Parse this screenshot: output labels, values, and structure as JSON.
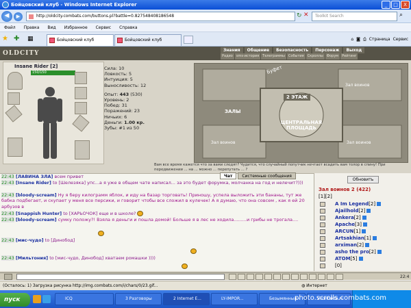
{
  "window": {
    "title": "Бойцовский клуб - Windows Internet Explorer",
    "minimize": "_",
    "maximize": "□",
    "close": "X"
  },
  "address": {
    "url": "http://oldcity.combats.com/buttons.pl?battle=0.827548408186548",
    "search_placeholder": "Toolkit Search"
  },
  "menu": [
    "Файл",
    "Правка",
    "Вид",
    "Избранное",
    "Сервис",
    "Справка"
  ],
  "tabs": [
    {
      "label": "Бойцовский клуб"
    },
    {
      "label": "Бойцовский клуб"
    }
  ],
  "ie_tools": {
    "page": "Страница",
    "service": "Сервис"
  },
  "game": {
    "logo": "OLDCITY",
    "menu_main": [
      "Знания",
      "Общение",
      "Безопасность",
      "Персонаж",
      "Выход"
    ],
    "menu_sub": [
      "Радио",
      "sms-история",
      "Телеграммы",
      "События",
      "Скроллы",
      "Форум",
      "Рейтинг"
    ],
    "character": {
      "name": "Insane Rider",
      "level": "[2]",
      "hp": "150/150"
    },
    "stats": {
      "strength": "Сила: 10",
      "agility": "Ловкость: 5",
      "intuition": "Интуиция: 5",
      "endurance": "Выносливость: 12",
      "exp_label": "Опыт:",
      "exp_value": "443",
      "exp_next": "(530)",
      "level": "Уровень: 2",
      "wins": "Побед: 31",
      "losses": "Поражений: 23",
      "draws": "Ничьих: 6",
      "money_label": "Деньги:",
      "money_value": "1.00 кр.",
      "teeth": "Зубы: #1 из 50"
    },
    "map": {
      "buffet": "Буфет",
      "floor2": "2 ЭТАЖ",
      "halls": "ЗАЛЫ",
      "central": "ЦЕНТРАЛЬНАЯ ПЛОЩАДЬ",
      "room_small": "Зал воинов",
      "hint": "Вам все время кажется что за вами следят? Чудится, что случайный попутчик нечтает всадить вам толор в спину! При передвижении ... на ... можно ... перепутать ... ?"
    },
    "chat_tabs": {
      "chat": "Чат",
      "system": "Системные сообщения"
    },
    "chat": [
      {
        "t": "22:43",
        "n": "[ЛАВИНА ЗЛА]",
        "x": "всем привет"
      },
      {
        "t": "22:43",
        "n": "[Insane Rider]",
        "x": "to [Шелезяка] упс...а я уже в общем чате написал... за это будет форумка, молчанка на год и нелечит?)))"
      },
      {
        "t": "22:43",
        "n": "[bloody-scream]",
        "x": "Ну я беру килограмм яблок, и иду на базар торговать! Приношу, успела выложить эти бананы, тут же бабка подбегает, и скупает у меня все персики, и говорит чтобы все сложил в кулечек! А я думаю, что она совсем , как я ей 20 арбузов в"
      },
      {
        "t": "22:43",
        "n": "[Snappish Hunter]",
        "x": "to [ХАРЬОЧОК] еще и в школе?"
      },
      {
        "t": "22:43",
        "n": "[bloody-scream]",
        "x": "сумку положу?! Взяла я деньги и пошла домой! Больше я в лес не ходила.........и грибы не трогала...."
      },
      {
        "t": "22:43",
        "n": "[мис-чудо]",
        "x": "to [Динобод]"
      },
      {
        "t": "22:43",
        "n": "[Мильтония]",
        "x": "to [мис-чудо, Динобод] хватаем ромашки ))))"
      }
    ],
    "room": {
      "refresh": "Обновить",
      "title": "Зал воинов 2 (422)",
      "pages": "[1][2]",
      "players": [
        {
          "name": "A Im Legend",
          "level": "[2]"
        },
        {
          "name": "Ajailhold",
          "level": "[2]"
        },
        {
          "name": "Ankera",
          "level": "[2]"
        },
        {
          "name": "Apache",
          "level": "[3]"
        },
        {
          "name": "ARCUN",
          "level": "[1]"
        },
        {
          "name": "Artsakhian",
          "level": "[1]"
        },
        {
          "name": "arximan",
          "level": "[2]"
        },
        {
          "name": "asho the pro",
          "level": "[2]"
        },
        {
          "name": "ATOM",
          "level": "[5]"
        },
        {
          "name": "",
          "level": "[0]"
        }
      ]
    },
    "clock": "22:4"
  },
  "status": {
    "text": "(Осталось: 1) Загрузка рисунка http://img.combats.com/i/chars/0/23.gif...",
    "zone": "Интернет"
  },
  "taskbar": {
    "start": "пуск",
    "items": [
      "ICQ",
      "3 Разговоры",
      "2 Internet E...",
      "LY-IMPOR...",
      "Безымянный -",
      "Vkontakte.ru"
    ]
  },
  "watermark": "photo.scrolls.combats.com"
}
